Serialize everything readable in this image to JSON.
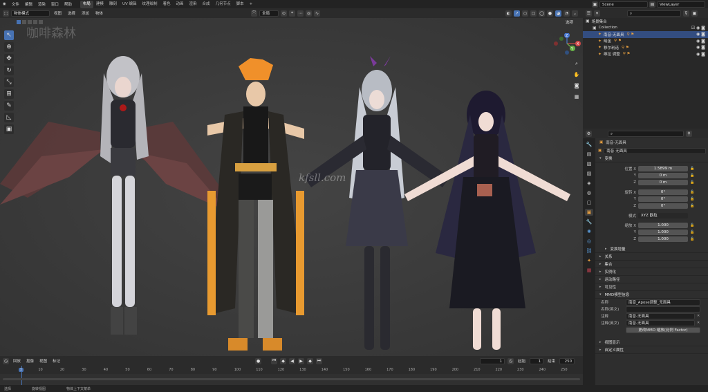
{
  "menu": {
    "items": [
      "文件",
      "编辑",
      "渲染",
      "窗口",
      "帮助"
    ],
    "workspaces": [
      "布局",
      "建模",
      "雕刻",
      "UV 编辑",
      "纹理绘制",
      "着色",
      "动画",
      "渲染",
      "合成",
      "几何节点",
      "脚本"
    ],
    "active_workspace": "布局",
    "scene": "Scene",
    "view_layer": "ViewLayer"
  },
  "viewport_header": {
    "mode": "物体模式",
    "menus": [
      "视图",
      "选择",
      "添加",
      "物体"
    ],
    "orientation": "全局",
    "options": "选项"
  },
  "viewport": {
    "watermark_top": "咖啡森林",
    "watermark_center": "kfsll.com",
    "gizmo": {
      "x": "X",
      "y": "Y",
      "z": "Z"
    }
  },
  "timeline": {
    "menus": [
      "回放",
      "抠像",
      "视图",
      "标记"
    ],
    "current_frame": "1",
    "start_label": "起始",
    "start": "1",
    "end_label": "结束",
    "end": "250",
    "ruler": [
      "1",
      "10",
      "20",
      "30",
      "40",
      "50",
      "60",
      "70",
      "80",
      "90",
      "100",
      "110",
      "120",
      "130",
      "140",
      "150",
      "160",
      "170",
      "180",
      "190",
      "200",
      "210",
      "220",
      "230",
      "240",
      "250"
    ]
  },
  "status": {
    "items": [
      "选择",
      "旋转视图",
      "物体上下文菜单"
    ]
  },
  "outliner": {
    "scene_collection": "场景集合",
    "collection": "Collection",
    "rows": [
      {
        "label": "南音-无面具",
        "selected": true
      },
      {
        "label": "纳金",
        "selected": false
      },
      {
        "label": "穆尔利诺",
        "selected": false
      },
      {
        "label": "维拉 调整",
        "selected": false
      }
    ]
  },
  "properties": {
    "object_header": "南音-无面具",
    "object_name": "南音-无面具",
    "transform_title": "变换",
    "location_label": "位置 X",
    "loc": [
      "1.5899 m",
      "0 m",
      "0 m"
    ],
    "rotation_label": "旋转 X",
    "rot": [
      "0°",
      "0°",
      "0°"
    ],
    "mode_label": "模式",
    "mode_value": "XYZ 欧拉",
    "scale_label": "缩放 X",
    "scale": [
      "1.000",
      "1.000",
      "1.000"
    ],
    "axis_y": "Y",
    "axis_z": "Z",
    "delta": "变换增量",
    "sections": [
      "关系",
      "集合",
      "实例化",
      "运动路径",
      "可见性"
    ],
    "mmd_title": "MMD模型信息",
    "mmd_name_label": "名称",
    "mmd_name_value": "南音_Apose调整_无面具",
    "mmd_name_e_label": "名称(英文)",
    "mmd_comment_label": "注释",
    "mmd_comment_value": "南音-无面具",
    "mmd_comment_e_label": "注释(英文)",
    "mmd_comment_e_value": "南音-无面具",
    "mmd_button": "更改MMD 缩放(比例 Factor)",
    "bottom_sections": [
      "视图显示",
      "自定义属性"
    ]
  },
  "colors": {
    "accent": "#4772b3",
    "orange": "#e8a040",
    "panel": "#2e2e2e"
  }
}
